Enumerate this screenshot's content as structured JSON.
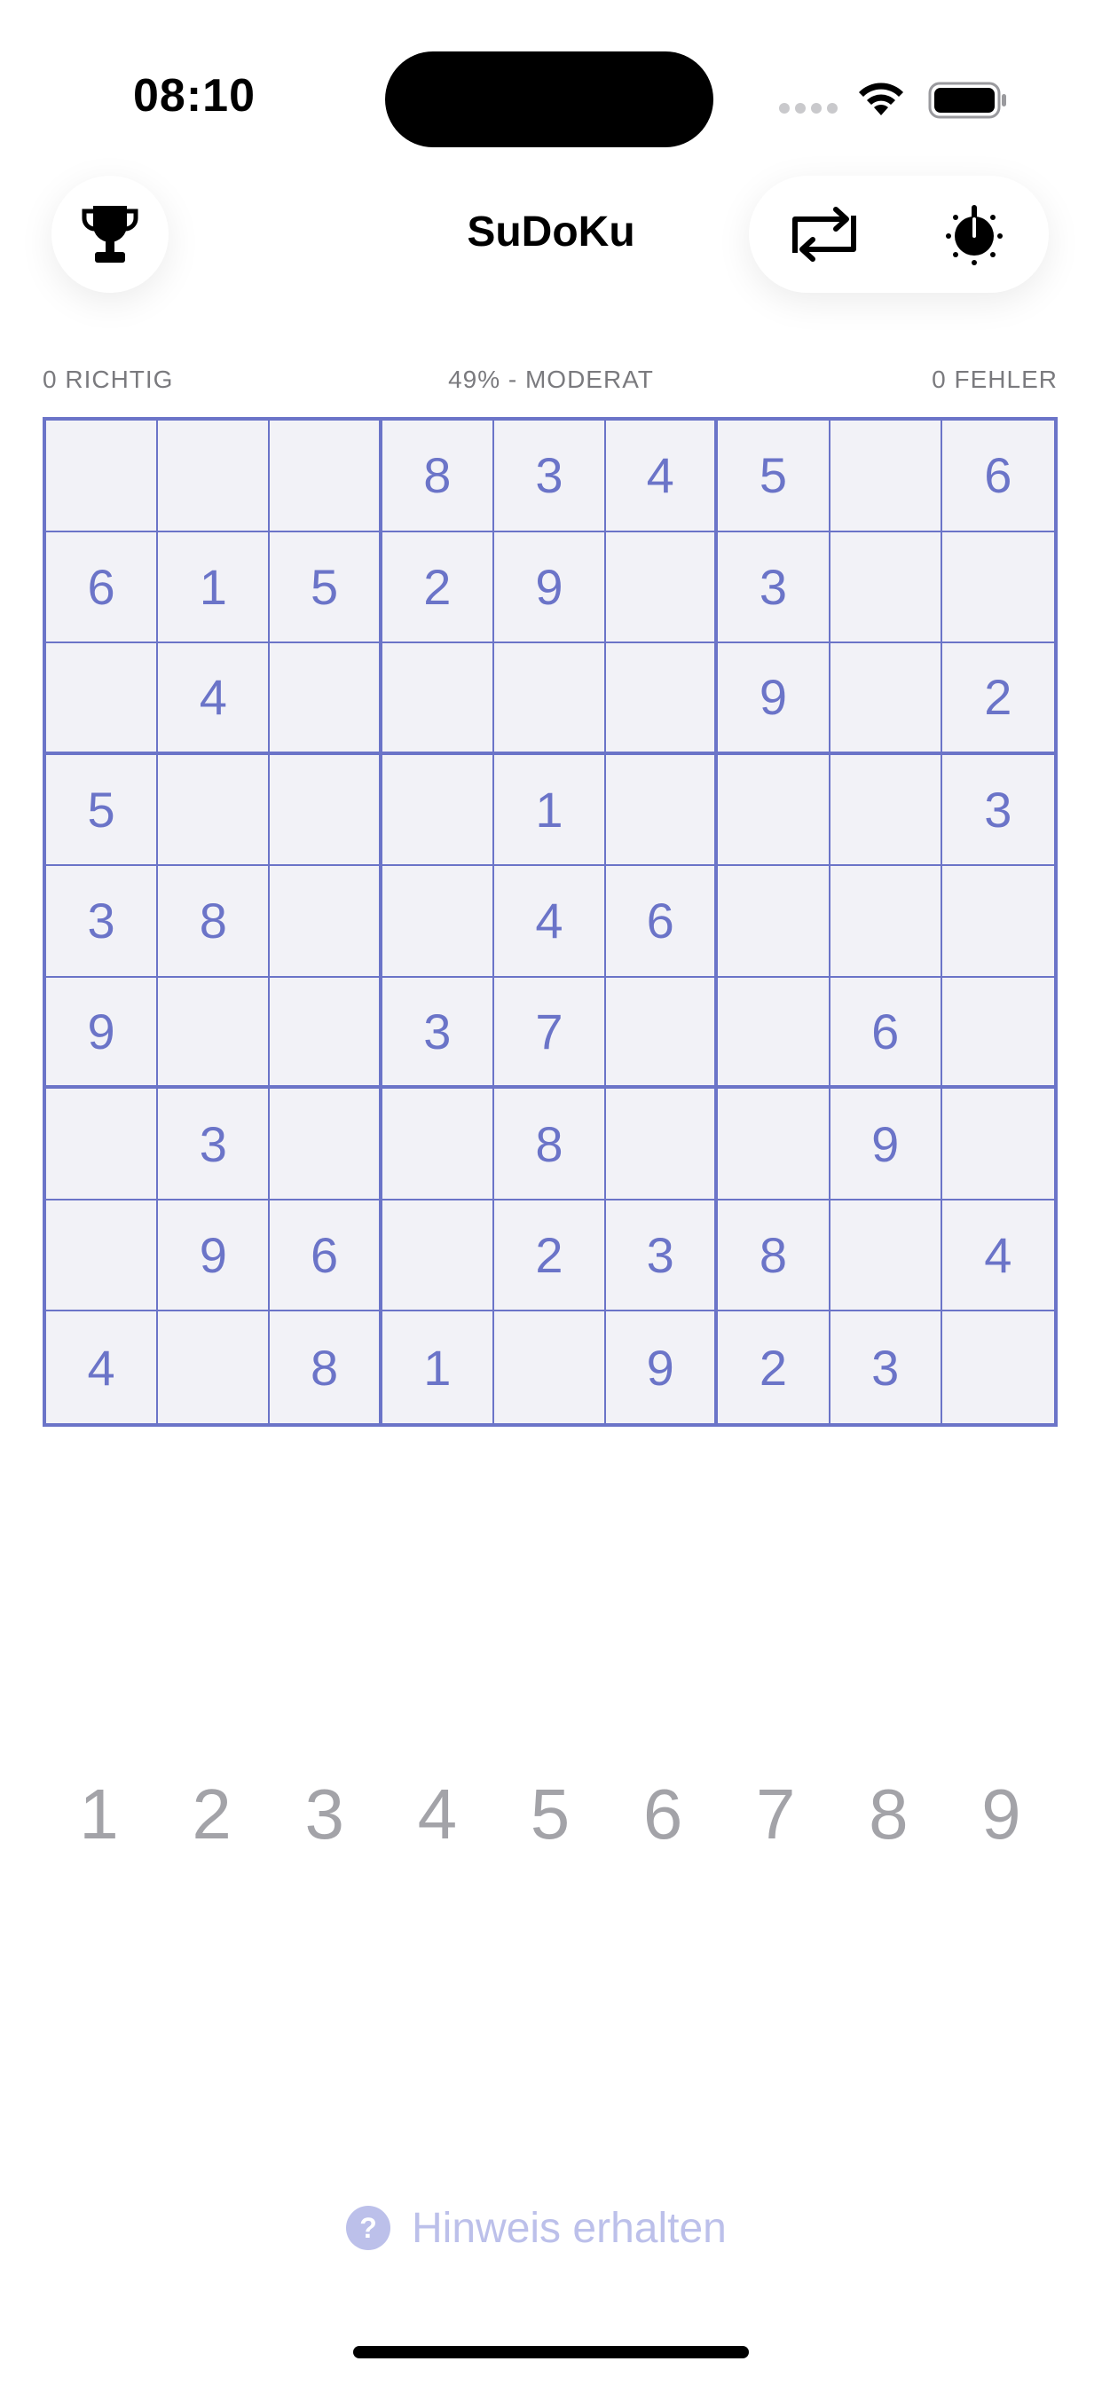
{
  "status_bar": {
    "time": "08:10"
  },
  "header": {
    "title": "SuDoKu",
    "trophy_icon": "trophy-icon",
    "refresh_icon": "refresh-icon",
    "timer_icon": "timer-icon"
  },
  "stats": {
    "correct": "0 RICHTIG",
    "difficulty": "49% - MODERAT",
    "errors": "0 FEHLER"
  },
  "board": [
    [
      "",
      "",
      "",
      "8",
      "3",
      "4",
      "5",
      "",
      "6"
    ],
    [
      "6",
      "1",
      "5",
      "2",
      "9",
      "",
      "3",
      "",
      ""
    ],
    [
      "",
      "4",
      "",
      "",
      "",
      "",
      "9",
      "",
      "2"
    ],
    [
      "5",
      "",
      "",
      "",
      "1",
      "",
      "",
      "",
      "3"
    ],
    [
      "3",
      "8",
      "",
      "",
      "4",
      "6",
      "",
      "",
      ""
    ],
    [
      "9",
      "",
      "",
      "3",
      "7",
      "",
      "",
      "6",
      ""
    ],
    [
      "",
      "3",
      "",
      "",
      "8",
      "",
      "",
      "9",
      ""
    ],
    [
      "",
      "9",
      "6",
      "",
      "2",
      "3",
      "8",
      "",
      "4"
    ],
    [
      "4",
      "",
      "8",
      "1",
      "",
      "9",
      "2",
      "3",
      ""
    ]
  ],
  "numpad": [
    "1",
    "2",
    "3",
    "4",
    "5",
    "6",
    "7",
    "8",
    "9"
  ],
  "hint": {
    "icon": "?",
    "label": "Hinweis erhalten"
  },
  "colors": {
    "grid": "#6b74c8",
    "cell_bg": "#f2f2f7",
    "hint": "#bcc0ea",
    "numpad": "#a3a3a8"
  }
}
